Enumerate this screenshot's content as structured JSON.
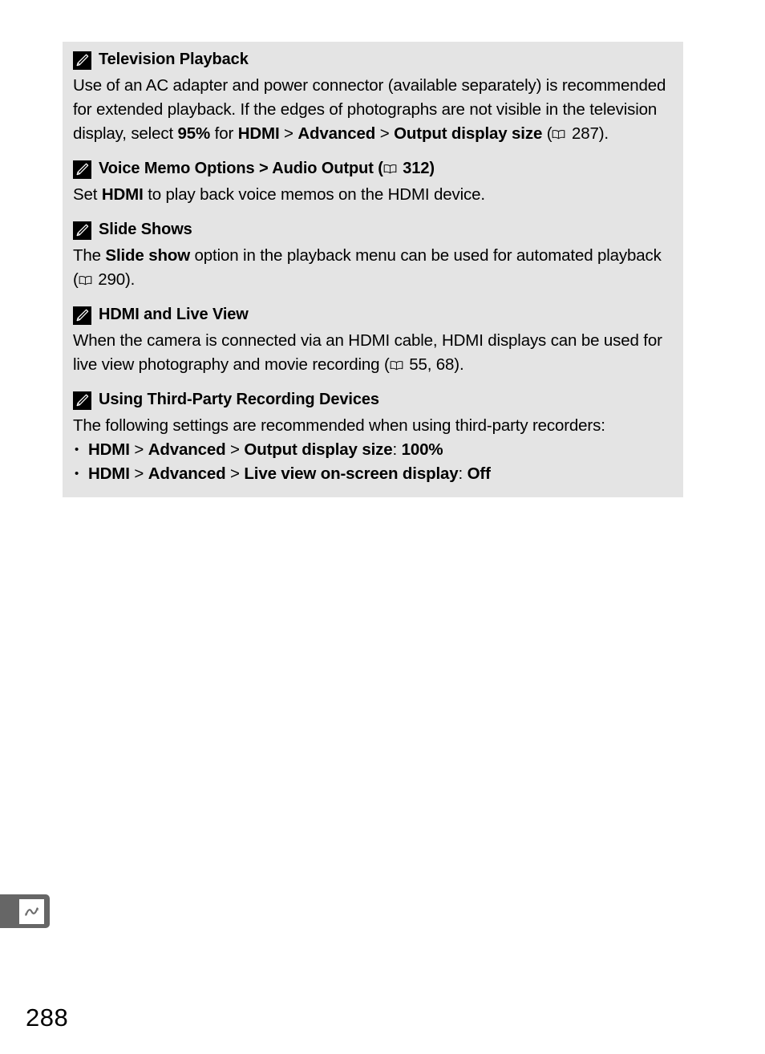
{
  "page": {
    "number": "288",
    "background_color": "#ffffff",
    "panel_color": "#e4e4e4"
  },
  "menu_tab": {
    "icon": "zigzag-arrow-icon",
    "color": "#666666"
  },
  "icons": {
    "heading": "pencil-icon",
    "page_reference": "book-icon"
  },
  "notes": [
    {
      "id": "television-playback",
      "heading": "Television Playback",
      "body_segments": [
        {
          "text": "Use of an AC adapter and power connector (available separately) is recommended for extended playback.  If the edges of photographs are not visible in the television display, select ",
          "bold": false
        },
        {
          "text": "95%",
          "bold": true
        },
        {
          "text": " for ",
          "bold": false
        },
        {
          "text": "HDMI",
          "bold": true
        },
        {
          "text": " > ",
          "bold": false
        },
        {
          "text": "Advanced",
          "bold": true
        },
        {
          "text": " > ",
          "bold": false
        },
        {
          "text": "Output display size",
          "bold": true
        },
        {
          "text": " (",
          "bold": false
        },
        {
          "text": "book-icon",
          "icon": true
        },
        {
          "text": " 287).",
          "bold": false
        }
      ]
    },
    {
      "id": "voice-memo-options",
      "heading_segments": [
        {
          "text": "Voice Memo Options > Audio Output (",
          "bold": true
        },
        {
          "text": "book-icon",
          "icon": true
        },
        {
          "text": " 312)",
          "bold": true
        }
      ],
      "heading": "Voice Memo Options > Audio Output (",
      "heading_suffix": " 312)",
      "body_segments": [
        {
          "text": "Set ",
          "bold": false
        },
        {
          "text": "HDMI",
          "bold": true
        },
        {
          "text": " to play back voice memos on the HDMI device.",
          "bold": false
        }
      ]
    },
    {
      "id": "slide-shows",
      "heading": "Slide Shows",
      "body_segments": [
        {
          "text": "The ",
          "bold": false
        },
        {
          "text": "Slide show",
          "bold": true
        },
        {
          "text": " option in the playback menu can be used for automated playback (",
          "bold": false
        },
        {
          "text": "book-icon",
          "icon": true
        },
        {
          "text": " 290).",
          "bold": false
        }
      ]
    },
    {
      "id": "hdmi-and-live-view",
      "heading": "HDMI and Live View",
      "body_segments": [
        {
          "text": "When the camera is connected via an HDMI cable, HDMI displays can be used for live view photography and movie recording (",
          "bold": false
        },
        {
          "text": "book-icon",
          "icon": true
        },
        {
          "text": " 55, 68).",
          "bold": false
        }
      ]
    },
    {
      "id": "using-third-party-recording-devices",
      "heading": "Using Third-Party Recording Devices",
      "body_segments": [
        {
          "text": "The following settings are recommended when using third-party recorders:",
          "bold": false
        }
      ],
      "bullets": [
        {
          "segments": [
            {
              "text": "HDMI",
              "bold": true
            },
            {
              "text": " > ",
              "bold": false
            },
            {
              "text": "Advanced",
              "bold": true
            },
            {
              "text": " > ",
              "bold": false
            },
            {
              "text": "Output display size",
              "bold": true
            },
            {
              "text": ": ",
              "bold": false
            },
            {
              "text": "100%",
              "bold": true
            }
          ]
        },
        {
          "segments": [
            {
              "text": "HDMI",
              "bold": true
            },
            {
              "text": " > ",
              "bold": false
            },
            {
              "text": "Advanced",
              "bold": true
            },
            {
              "text": " > ",
              "bold": false
            },
            {
              "text": "Live view on-screen display",
              "bold": true
            },
            {
              "text": ": ",
              "bold": false
            },
            {
              "text": "Off",
              "bold": true
            }
          ]
        }
      ]
    }
  ]
}
